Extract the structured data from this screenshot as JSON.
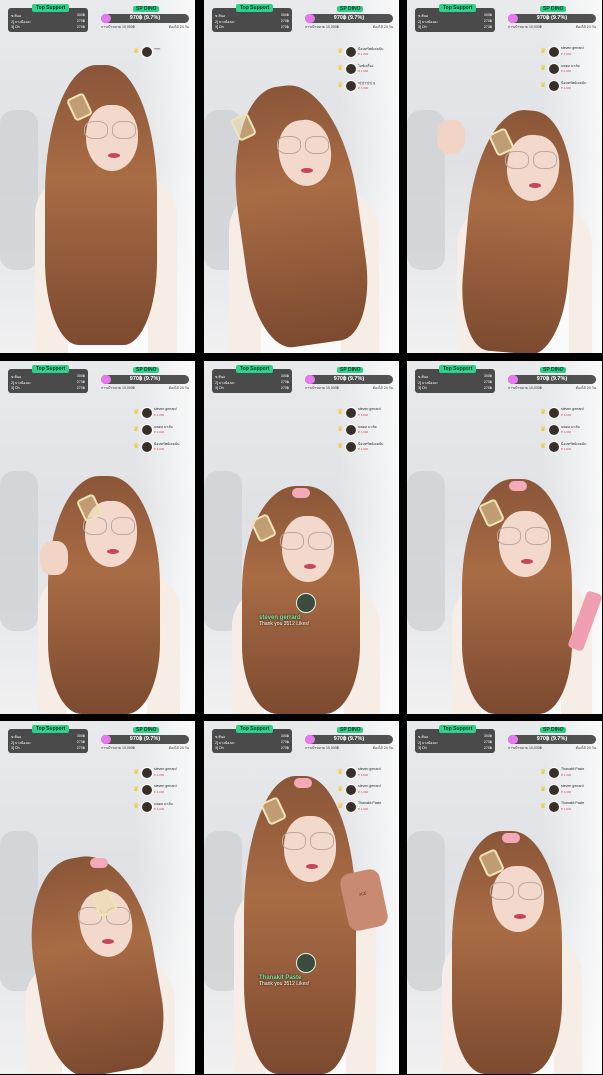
{
  "colors": {
    "accent_green": "#2fd18a",
    "progress_pink": "#e579ed",
    "overlay_dark": "#1e1e1e",
    "hair": "#a96c45",
    "like_name_green": "#6ee7a4"
  },
  "tiles": [
    {
      "top_support": {
        "title": "Top Support",
        "rows": [
          {
            "name": "ข ต้นอ",
            "value": "300฿"
          },
          {
            "name": "2] บางน้องอะ",
            "value": "270฿"
          },
          {
            "name": "3] Oh",
            "value": "270฿"
          }
        ]
      },
      "sp": {
        "label": "SP DINO",
        "amount": "970฿ (9.7%)",
        "progress": 0.097,
        "left_sub": "การเป้าหมาย 10,000฿",
        "right_sub": "ต้องได้ 24 วัน"
      },
      "gifters": [
        {
          "name": "ᴗ͈ᴗ͈ᴗ͈",
          "stat": ""
        }
      ]
    },
    {
      "top_support": {
        "title": "Top Support",
        "rows": [
          {
            "name": "ข ต้นอ",
            "value": "300฿"
          },
          {
            "name": "2] บางน้องอะ",
            "value": "270฿"
          },
          {
            "name": "3] Oh",
            "value": "270฿"
          }
        ]
      },
      "sp": {
        "label": "SP DINO",
        "amount": "970฿ (9.7%)",
        "progress": 0.097,
        "left_sub": "การเป้าหมาย 10,000฿",
        "right_sub": "ต้องได้ 24 วัน"
      },
      "gifters": [
        {
          "name": "ป้อมทรัพย์เคยนับ",
          "stat": "♥ 1,000"
        },
        {
          "name": "ไอซ์เครื่อง",
          "stat": "♥ 1,000"
        },
        {
          "name": "ก(ๆ)ๆๆ(ๆ) ฐ",
          "stat": "♥ 1,000"
        }
      ]
    },
    {
      "top_support": {
        "title": "Top Support",
        "rows": [
          {
            "name": "ข ต้นอ",
            "value": "300฿"
          },
          {
            "name": "2] บางน้องอะ",
            "value": "270฿"
          },
          {
            "name": "3] Oh",
            "value": "270฿"
          }
        ]
      },
      "sp": {
        "label": "SP DINO",
        "amount": "970฿ (9.7%)",
        "progress": 0.097,
        "left_sub": "การเป้าหมาย 10,000฿",
        "right_sub": "ต้องได้ 24 วัน"
      },
      "gifters": [
        {
          "name": "steven gerrard",
          "stat": "♥ 1,000"
        },
        {
          "name": "นพดล มาลัย",
          "stat": "♥ 1,000"
        },
        {
          "name": "ป้อมทรัพย์เคยนับ",
          "stat": "♥ 1,000"
        }
      ]
    },
    {
      "top_support": {
        "title": "Top Support",
        "rows": [
          {
            "name": "ข ต้นอ",
            "value": "300฿"
          },
          {
            "name": "2] บางน้องอะ",
            "value": "270฿"
          },
          {
            "name": "3] Oh",
            "value": "270฿"
          }
        ]
      },
      "sp": {
        "label": "SP DINO",
        "amount": "970฿ (9.7%)",
        "progress": 0.097,
        "left_sub": "การเป้าหมาย 10,000฿",
        "right_sub": "ต้องได้ 24 วัน"
      },
      "gifters": [
        {
          "name": "steven gerrard",
          "stat": "♥ 1,000"
        },
        {
          "name": "นพดล มาลัย",
          "stat": "♥ 1,000"
        },
        {
          "name": "ป้อมทรัพย์เคยนับ",
          "stat": "♥ 1,000"
        }
      ]
    },
    {
      "top_support": {
        "title": "Top Support",
        "rows": [
          {
            "name": "ข ต้นอ",
            "value": "300฿"
          },
          {
            "name": "2] บางน้องอะ",
            "value": "270฿"
          },
          {
            "name": "3] Oh",
            "value": "270฿"
          }
        ]
      },
      "sp": {
        "label": "SP DINO",
        "amount": "970฿ (9.7%)",
        "progress": 0.097,
        "left_sub": "การเป้าหมาย 10,000฿",
        "right_sub": "ต้องได้ 24 วัน"
      },
      "gifters": [
        {
          "name": "steven gerrard",
          "stat": "♥ 1,000"
        },
        {
          "name": "นพดล มาลัย",
          "stat": "♥ 1,000"
        },
        {
          "name": "ป้อมทรัพย์เคยนับ",
          "stat": "♥ 1,000"
        }
      ],
      "like": {
        "name": "steven gerrard",
        "text": "Thank you 3512 Likes!"
      }
    },
    {
      "top_support": {
        "title": "Top Support",
        "rows": [
          {
            "name": "ข ต้นอ",
            "value": "300฿"
          },
          {
            "name": "2] บางน้องอะ",
            "value": "270฿"
          },
          {
            "name": "3] Oh",
            "value": "270฿"
          }
        ]
      },
      "sp": {
        "label": "SP DINO",
        "amount": "970฿ (9.7%)",
        "progress": 0.097,
        "left_sub": "การเป้าหมาย 10,000฿",
        "right_sub": "ต้องได้ 24 วัน"
      },
      "gifters": [
        {
          "name": "steven gerrard",
          "stat": "♥ 1,000"
        },
        {
          "name": "นพดล มาลัย",
          "stat": "♥ 1,000"
        },
        {
          "name": "ป้อมทรัพย์เคยนับ",
          "stat": "♥ 1,000"
        }
      ]
    },
    {
      "top_support": {
        "title": "Top Support",
        "rows": [
          {
            "name": "ข ต้นอ",
            "value": "300฿"
          },
          {
            "name": "2] บางน้องอะ",
            "value": "270฿"
          },
          {
            "name": "3] Oh",
            "value": "270฿"
          }
        ]
      },
      "sp": {
        "label": "SP DINO",
        "amount": "970฿ (9.7%)",
        "progress": 0.097,
        "left_sub": "การเป้าหมาย 10,000฿",
        "right_sub": "ต้องได้ 24 วัน"
      },
      "gifters": [
        {
          "name": "steven gerrard",
          "stat": "♥ 1,000"
        },
        {
          "name": "steven gerrard",
          "stat": "♥ 1,000"
        },
        {
          "name": "นพดล มาลัย",
          "stat": "♥ 1,000"
        }
      ]
    },
    {
      "top_support": {
        "title": "Top Support",
        "rows": [
          {
            "name": "ข ต้นอ",
            "value": "300฿"
          },
          {
            "name": "2] บางน้องอะ",
            "value": "270฿"
          },
          {
            "name": "3] Oh",
            "value": "270฿"
          }
        ]
      },
      "sp": {
        "label": "SP DINO",
        "amount": "970฿ (9.7%)",
        "progress": 0.097,
        "left_sub": "การเป้าหมาย 10,000฿",
        "right_sub": "ต้องได้ 24 วัน"
      },
      "gifters": [
        {
          "name": "steven gerrard",
          "stat": "♥ 1,000"
        },
        {
          "name": "steven gerrard",
          "stat": "♥ 1,000"
        },
        {
          "name": "Thanakit Paste",
          "stat": "♥ 1,000"
        }
      ],
      "like": {
        "name": "Thanakit Paste",
        "text": "Thank you 3512 Likes!"
      },
      "mirror_text": "3CE"
    },
    {
      "top_support": {
        "title": "Top Support",
        "rows": [
          {
            "name": "ข ต้นอ",
            "value": "300฿"
          },
          {
            "name": "2] บางน้องอะ",
            "value": "270฿"
          },
          {
            "name": "3] Oh",
            "value": "270฿"
          }
        ]
      },
      "sp": {
        "label": "SP DINO",
        "amount": "970฿ (9.7%)",
        "progress": 0.097,
        "left_sub": "การเป้าหมาย 10,000฿",
        "right_sub": "ต้องได้ 24 วัน"
      },
      "gifters": [
        {
          "name": "Thanakit Paste",
          "stat": "♥ 1,000"
        },
        {
          "name": "steven gerrard",
          "stat": "♥ 1,000"
        },
        {
          "name": "Thanakit Paste",
          "stat": "♥ 1,000"
        }
      ]
    }
  ]
}
